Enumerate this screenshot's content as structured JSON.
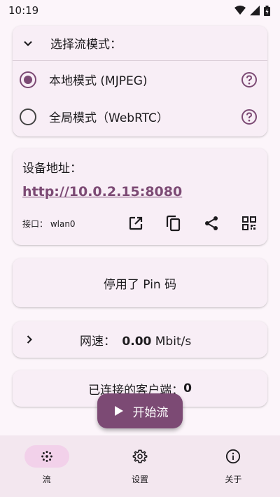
{
  "status_bar": {
    "time": "10:19"
  },
  "mode_card": {
    "title": "选择流模式：",
    "options": [
      {
        "label": "本地模式 (MJPEG)",
        "selected": true
      },
      {
        "label": "全局模式（WebRTC）",
        "selected": false
      }
    ]
  },
  "address_card": {
    "title": "设备地址：",
    "url": "http://10.0.2.15:8080",
    "interface_label": "接口：  wlan0"
  },
  "pin_card": {
    "label": "停用了 Pin 码"
  },
  "speed_card": {
    "label": "网速：",
    "value": "0.00",
    "unit": "Mbit/s"
  },
  "clients_card": {
    "label": "已连接的客户端：",
    "count": "0"
  },
  "fab": {
    "label": "开始流"
  },
  "nav": {
    "items": [
      {
        "label": "流",
        "icon": "stream-icon",
        "active": true
      },
      {
        "label": "设置",
        "icon": "gear-icon",
        "active": false
      },
      {
        "label": "关于",
        "icon": "info-icon",
        "active": false
      }
    ]
  },
  "colors": {
    "accent": "#7c4a74",
    "background": "#fcf5fa",
    "card": "#f8eef6",
    "nav_active": "#f2d1ea"
  }
}
